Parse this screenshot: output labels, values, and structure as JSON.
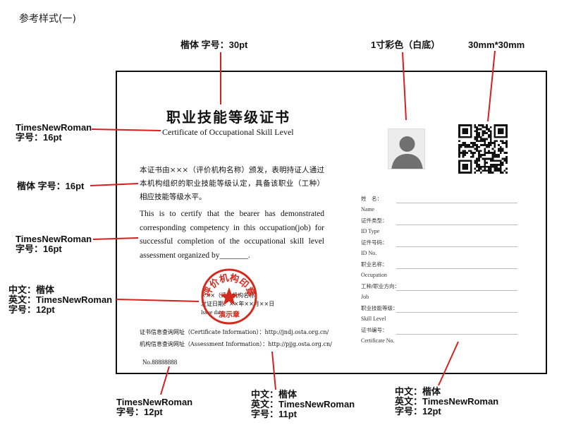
{
  "page": {
    "heading": "参考样式(一)"
  },
  "certificate": {
    "title": "职业技能等级证书",
    "subtitle": "Certificate of Occupational Skill Level",
    "cn_paragraph": "本证书由×××（评价机构名称）颁发，表明持证人通过本机构组织的职业技能等级认定，具备该职业（工种）相应技能等级水平。",
    "en_paragraph": "This is to certify that the bearer has demonstrated corresponding competency in this occupation(job) for successful completion of the occupational skill level assessment organized by_______.",
    "issuer_line": "×××（评价机构名称）",
    "issue_date_cn": "发证日期：××年××月××日",
    "issue_date_en": "Issue date",
    "url_line_1": "证书信息查询网址（Certificate Information）：http://jndj.osta.org.cn/",
    "url_line_2": "机构信息查询网址（Assessment Information）：http://pjjg.osta.org.cn/",
    "number": "No.88888888",
    "seal_text": "评价机构印章",
    "seal_bottom": "演示章",
    "fields": [
      {
        "cn": "姓　名：",
        "en": "Name"
      },
      {
        "cn": "证件类型：",
        "en": "ID Type"
      },
      {
        "cn": "证件号码：",
        "en": "ID No."
      },
      {
        "cn": "职业名称：",
        "en": "Occupation"
      },
      {
        "cn": "工种/职业方向：",
        "en": "Job"
      },
      {
        "cn": "职业技能等级：",
        "en": "Skill Level"
      },
      {
        "cn": "证书编号：",
        "en": "Certificate No."
      }
    ]
  },
  "annotations": {
    "title_font": "楷体 字号：30pt",
    "photo": "1寸彩色（白底）",
    "qr": "30mm*30mm",
    "subtitle_font_1": "TimesNewRoman",
    "subtitle_font_2": "字号：16pt",
    "cn_para_font": "楷体 字号：16pt",
    "en_para_font_1": "TimesNewRoman",
    "en_para_font_2": "字号：16pt",
    "issuer_font_1": "中文：楷体",
    "issuer_font_2": "英文：TimesNewRoman",
    "issuer_font_3": "字号：12pt",
    "no_font_1": "TimesNewRoman",
    "no_font_2": "字号：12pt",
    "url_font_1": "中文：楷体",
    "url_font_2": "英文：TimesNewRoman",
    "url_font_3": "字号：11pt",
    "field_font_1": "中文：楷体",
    "field_font_2": "英文：TimesNewRoman",
    "field_font_3": "字号：12pt"
  },
  "colors": {
    "callout": "#d62020",
    "seal": "#d42a1e",
    "border": "#111111"
  }
}
